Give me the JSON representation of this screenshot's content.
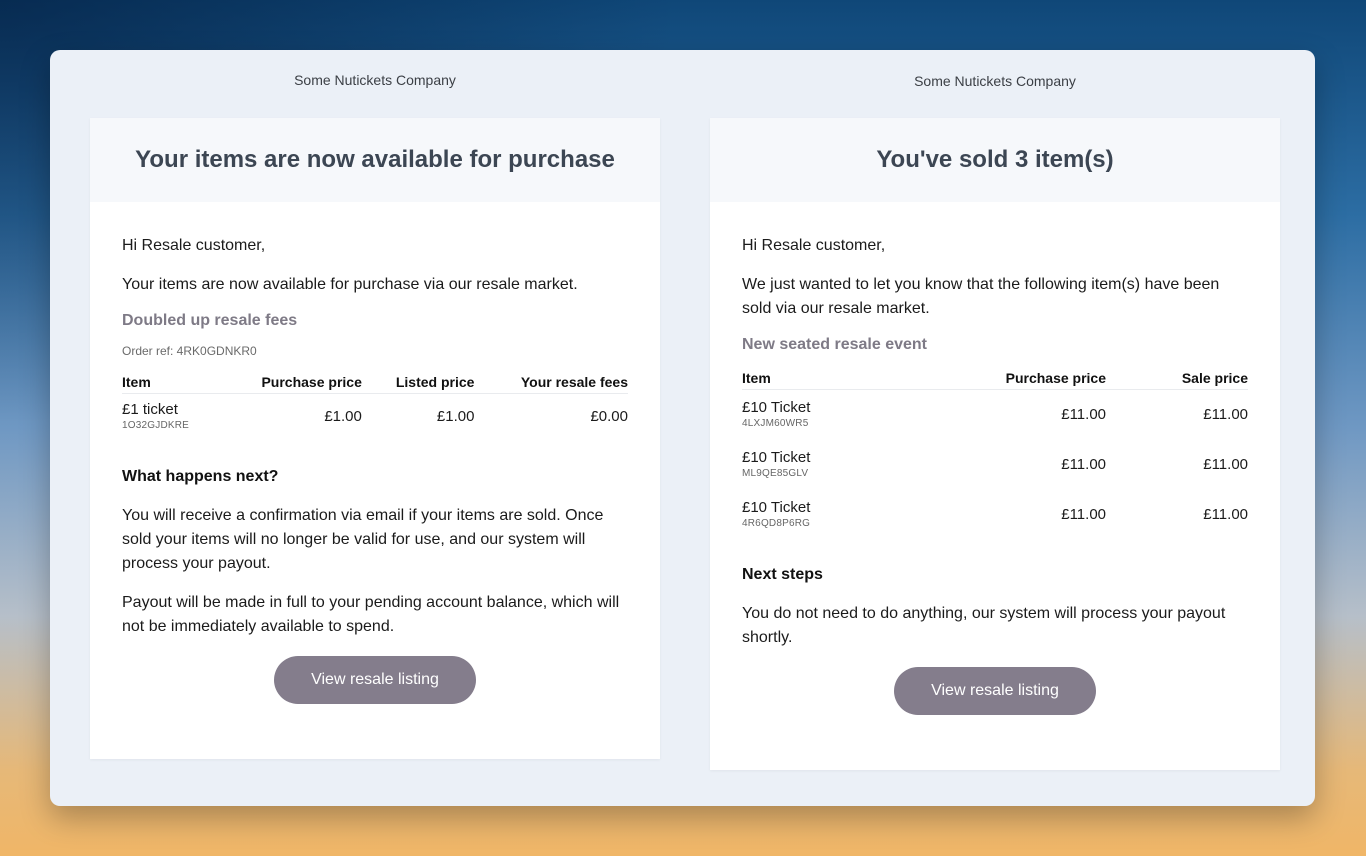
{
  "left": {
    "company": "Some Nutickets Company",
    "title": "Your items are now available for purchase",
    "greeting": "Hi Resale customer,",
    "intro": "Your items are now available for purchase via our resale market.",
    "event_name": "Doubled up resale fees",
    "order_ref": "Order ref: 4RK0GDNKR0",
    "columns": [
      "Item",
      "Purchase price",
      "Listed price",
      "Your resale fees"
    ],
    "rows": [
      {
        "name": "£1 ticket",
        "code": "1O32GJDKRE",
        "purchase": "£1.00",
        "listed": "£1.00",
        "fees": "£0.00"
      }
    ],
    "next_heading": "What happens next?",
    "next_p1": "You will receive a confirmation via email if your items are sold. Once sold your items will no longer be valid for use, and our system will process your payout.",
    "next_p2": "Payout will be made in full to your pending account balance, which will not be immediately available to spend.",
    "button": "View resale listing"
  },
  "right": {
    "company": "Some Nutickets Company",
    "title": "You've sold 3 item(s)",
    "greeting": "Hi Resale customer,",
    "intro": "We just wanted to let you know that the following item(s) have been sold via our resale market.",
    "event_name": "New seated resale event",
    "columns": [
      "Item",
      "Purchase price",
      "Sale price"
    ],
    "rows": [
      {
        "name": "£10 Ticket",
        "code": "4LXJM60WR5",
        "purchase": "£11.00",
        "sale": "£11.00"
      },
      {
        "name": "£10 Ticket",
        "code": "ML9QE85GLV",
        "purchase": "£11.00",
        "sale": "£11.00"
      },
      {
        "name": "£10 Ticket",
        "code": "4R6QD8P6RG",
        "purchase": "£11.00",
        "sale": "£11.00"
      }
    ],
    "next_heading": "Next steps",
    "next_p1": "You do not need to do anything, our system will process your payout shortly.",
    "button": "View resale listing"
  },
  "colors": {
    "button": "#847d8c",
    "title": "#3c4653",
    "event_name": "#7e7a86",
    "panel": "#ebf0f7"
  }
}
